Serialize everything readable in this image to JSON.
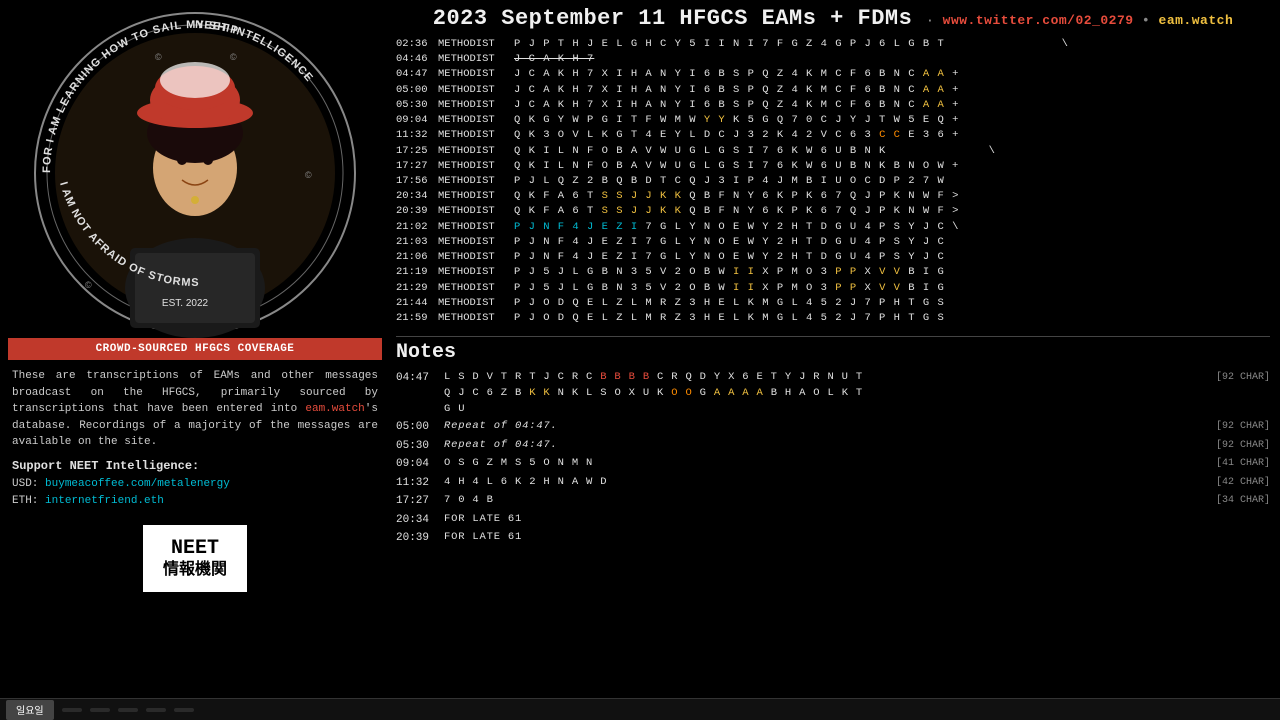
{
  "left": {
    "circle_text_top": "FOR I AM LEARNING HOW TO SAIL MY SHIP",
    "circle_text_bottom": "I AM NOT AFRAID OF STORMS",
    "circle_text_right": "NEET INTELLIGENCE",
    "circle_text_est": "EST. 2022",
    "banner": "CROWD-SOURCED HFGCS COVERAGE",
    "description": "These are transcriptions of EAMs and other messages broadcast on the HFGCS, primarily sourced by transcriptions that have been entered into ",
    "eam_watch_link": "eam.watch",
    "description2": "'s database. Recordings of a majority of the messages are available on the site.",
    "support_title": "Support NEET Intelligence:",
    "usd_label": "USD:",
    "usd_link": "buymeacoffee.com/metalenergy",
    "eth_label": "ETH:",
    "eth_link": "internetfriend.eth",
    "neet_label": "NEET",
    "neet_kanji": "情報機関"
  },
  "header": {
    "title": "2023 September 11 HFGCS EAMs + FDMs",
    "separator": "·",
    "twitter": "www.twitter.com/02_0279",
    "dot": "•",
    "eam_watch": "eam.watch"
  },
  "eam_rows": [
    {
      "time": "02:36",
      "station": "METHODIST",
      "msg": "P J P T H J E L G H C Y 5 I I N I 7 F G Z 4 G P J 6 L G B T",
      "highlights": [],
      "suffix": "\\"
    },
    {
      "time": "04:46",
      "station": "METHODIST",
      "msg": "J C A K H 7",
      "highlights": [
        "J",
        "C",
        "A",
        "K",
        "H",
        "7"
      ],
      "strikethrough": true,
      "suffix": "\\"
    },
    {
      "time": "04:47",
      "station": "METHODIST",
      "msg": "J C A K H 7 X I H A N Y I 6 B S P Q Z 4 K M C F 6 B N C A A",
      "highlights": [
        "A",
        "A"
      ],
      "suffix": "+"
    },
    {
      "time": "05:00",
      "station": "METHODIST",
      "msg": "J C A K H 7 X I H A N Y I 6 B S P Q Z 4 K M C F 6 B N C A A",
      "highlights": [
        "A",
        "A"
      ],
      "suffix": "+"
    },
    {
      "time": "05:30",
      "station": "METHODIST",
      "msg": "J C A K H 7 X I H A N Y I 6 B S P Q Z 4 K M C F 6 B N C A A",
      "highlights": [
        "A",
        "A"
      ],
      "suffix": "+"
    },
    {
      "time": "09:04",
      "station": "METHODIST",
      "msg": "Q K G Y W P G I T F W M W Y Y K 5 G Q 7 0 C J Y J T W 5 E Q",
      "highlights": [
        "Y",
        "Y"
      ],
      "suffix": "+"
    },
    {
      "time": "11:32",
      "station": "METHODIST",
      "msg": "Q K 3 O V L K G T 4 E Y L D C J 3 2 K 4 2 V C 6 3 C C E 3 6",
      "highlights": [
        "C",
        "C"
      ],
      "suffix": "+"
    },
    {
      "time": "17:25",
      "station": "METHODIST",
      "msg": "Q K I L N F O B A V W U G L G S I 7 6 K W 6 U B N K",
      "highlights": [],
      "suffix": "\\"
    },
    {
      "time": "17:27",
      "station": "METHODIST",
      "msg": "Q K I L N F O B A V W U G L G S I 7 6 K W 6 U B N K B N O W",
      "highlights": [],
      "suffix": "+"
    },
    {
      "time": "17:56",
      "station": "METHODIST",
      "msg": "P J L Q Z 2 B Q B D T C Q J 3 I P 4 J M B I U O C D P 2 7 W",
      "highlights": [],
      "suffix": ""
    },
    {
      "time": "20:34",
      "station": "METHODIST",
      "msg": "Q K F A 6 T S S J J K K Q B F N Y 6 K P K 6 7 Q J P K N W F",
      "highlights": [
        "S",
        "S",
        "J",
        "J",
        "K",
        "K"
      ],
      "suffix": ">"
    },
    {
      "time": "20:39",
      "station": "METHODIST",
      "msg": "Q K F A 6 T S S J J K K Q B F N Y 6 K P K 6 7 Q J P K N W F",
      "highlights": [
        "S",
        "S",
        "J",
        "J",
        "K",
        "K"
      ],
      "suffix": ">"
    },
    {
      "time": "21:02",
      "station": "METHODIST",
      "msg": "P J N F 4 J E Z I 7 G L Y N O E W Y 2 H T D G U 4 P S Y J C",
      "highlights": [
        "P",
        "J",
        "N",
        "F",
        "4",
        "J",
        "E",
        "Z",
        "I"
      ],
      "highlight_color": "cyan",
      "suffix": "\\"
    },
    {
      "time": "21:03",
      "station": "METHODIST",
      "msg": "P J N F 4 J E Z I 7 G L Y N O E W Y 2 H T D G U 4 P S Y J C",
      "highlights": [],
      "suffix": ""
    },
    {
      "time": "21:06",
      "station": "METHODIST",
      "msg": "P J N F 4 J E Z I 7 G L Y N O E W Y 2 H T D G U 4 P S Y J C",
      "highlights": [],
      "suffix": ""
    },
    {
      "time": "21:19",
      "station": "METHODIST",
      "msg": "P J 5 J L G B N 3 5 V 2 O B W I I X P M O 3 P P X V V B I G",
      "highlights": [
        "I",
        "I",
        "P",
        "P",
        "X",
        "V",
        "V"
      ],
      "suffix": ""
    },
    {
      "time": "21:29",
      "station": "METHODIST",
      "msg": "P J 5 J L G B N 3 5 V 2 O B W I I X P M O 3 P P X V V B I G",
      "highlights": [
        "I",
        "I",
        "P",
        "P",
        "X",
        "V",
        "V"
      ],
      "suffix": ""
    },
    {
      "time": "21:44",
      "station": "METHODIST",
      "msg": "P J O D Q E L Z L M R Z 3 H E L K M G L 4 5 2 J 7 P H T G S",
      "highlights": [],
      "suffix": ""
    },
    {
      "time": "21:59",
      "station": "METHODIST",
      "msg": "P J O D Q E L Z L M R Z 3 H E L K M G L 4 5 2 J 7 P H T G S",
      "highlights": [],
      "suffix": ""
    }
  ],
  "notes": {
    "title": "Notes",
    "items": [
      {
        "time": "04:47",
        "lines": [
          "L S D V T R T J C R C B B B B C R Q D Y X 6 E T Y J R N U T",
          "Q J C 6 Z B K K N K L S O X U K O O G A A A A B H A O L K T",
          "G U"
        ],
        "highlights": {
          "line0": [
            "B",
            "B",
            "B",
            "B"
          ],
          "line1": [
            "K",
            "K",
            "O",
            "O",
            "A",
            "A",
            "A",
            "A"
          ]
        },
        "char_count": "[92 CHAR]"
      },
      {
        "time": "05:00",
        "lines": [
          "Repeat of 04:47."
        ],
        "italic": true,
        "char_count": "[92 CHAR]"
      },
      {
        "time": "05:30",
        "lines": [
          "Repeat of 04:47."
        ],
        "italic": true,
        "char_count": "[92 CHAR]"
      },
      {
        "time": "09:04",
        "lines": [
          "O S G Z M S 5 O N M N"
        ],
        "char_count": "[41 CHAR]"
      },
      {
        "time": "11:32",
        "lines": [
          "4 H 4 L 6 K 2 H N A W D"
        ],
        "char_count": "[42 CHAR]"
      },
      {
        "time": "17:27",
        "lines": [
          "7 0 4 B"
        ],
        "char_count": "[34 CHAR]"
      },
      {
        "time": "20:34",
        "lines": [
          "FOR LATE 61"
        ],
        "char_count": ""
      },
      {
        "time": "20:39",
        "lines": [
          "FOR LATE 61"
        ],
        "char_count": ""
      }
    ]
  },
  "bottom_tabs": [
    "일요일",
    "",
    "",
    "",
    "",
    ""
  ]
}
